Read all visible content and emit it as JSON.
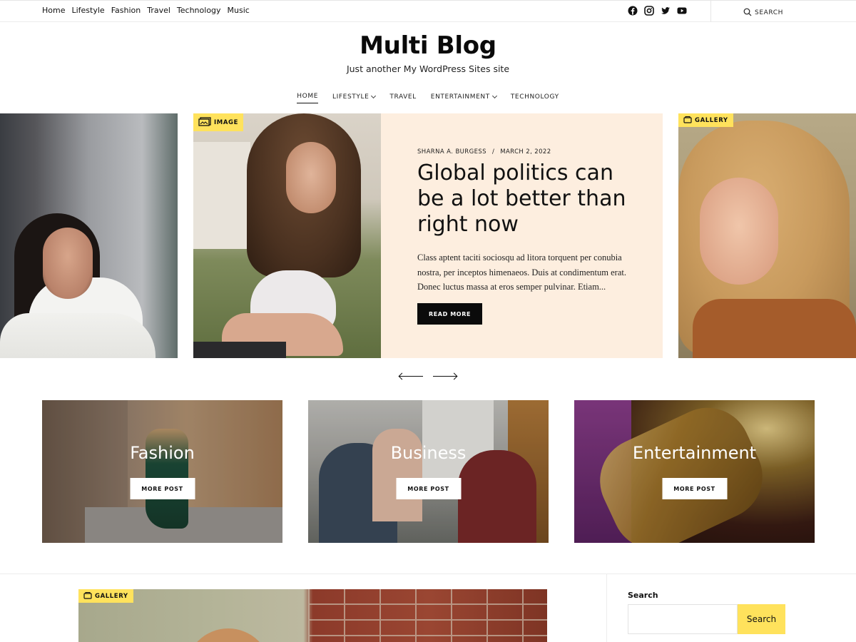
{
  "top_nav": [
    "Home",
    "Lifestyle",
    "Fashion",
    "Travel",
    "Technology",
    "Music"
  ],
  "social_icons": [
    "facebook-icon",
    "instagram-icon",
    "twitter-icon",
    "youtube-icon"
  ],
  "top_search_label": "SEARCH",
  "site": {
    "title": "Multi Blog",
    "tagline": "Just another My WordPress Sites site"
  },
  "main_nav": [
    {
      "label": "HOME",
      "active": true,
      "has_dropdown": false
    },
    {
      "label": "LIFESTYLE",
      "active": false,
      "has_dropdown": true
    },
    {
      "label": "TRAVEL",
      "active": false,
      "has_dropdown": false
    },
    {
      "label": "ENTERTAINMENT",
      "active": false,
      "has_dropdown": true
    },
    {
      "label": "TECHNOLOGY",
      "active": false,
      "has_dropdown": false
    }
  ],
  "slider": {
    "badge_main": "IMAGE",
    "badge_right": "GALLERY",
    "author": "SHARNA A. BURGESS",
    "separator": "/",
    "date": "MARCH 2, 2022",
    "title": "Global politics can be a lot better than right now",
    "excerpt": "Class aptent taciti sociosqu ad litora torquent per conubia nostra, per inceptos himenaeos. Duis at condimentum erat. Donec luctus massa at eros semper pulvinar. Etiam...",
    "read_more": "READ MORE"
  },
  "categories": [
    {
      "name": "Fashion",
      "button": "MORE POST"
    },
    {
      "name": "Business",
      "button": "MORE POST"
    },
    {
      "name": "Entertainment",
      "button": "MORE POST"
    }
  ],
  "post_badge": "GALLERY",
  "sidebar": {
    "search_title": "Search",
    "search_button": "Search",
    "search_value": ""
  },
  "colors": {
    "accent": "#ffe25c",
    "slide_bg": "#fdeedf",
    "dark": "#0b0b0b"
  }
}
